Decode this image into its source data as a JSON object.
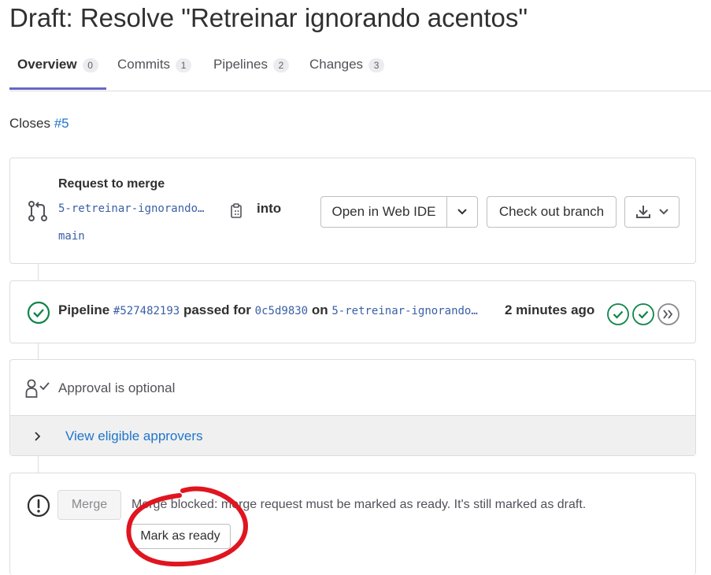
{
  "page": {
    "title": "Draft: Resolve \"Retreinar ignorando acentos\""
  },
  "tabs": [
    {
      "label": "Overview",
      "count": "0"
    },
    {
      "label": "Commits",
      "count": "1"
    },
    {
      "label": "Pipelines",
      "count": "2"
    },
    {
      "label": "Changes",
      "count": "3"
    }
  ],
  "description": {
    "prefix": "Closes",
    "issue_link": "#5"
  },
  "merge_request": {
    "heading": "Request to merge",
    "source_branch": "5-retreinar-ignorando…",
    "into_label": "into",
    "target_branch": "main",
    "open_web_ide": "Open in Web IDE",
    "checkout_branch": "Check out branch"
  },
  "pipeline": {
    "label": "Pipeline",
    "id": "#527482193",
    "status_text": "passed for",
    "commit": "0c5d9830",
    "on_label": "on",
    "branch": "5-retreinar-ignorando…",
    "time": "2 minutes ago",
    "stages": [
      "passed",
      "passed"
    ]
  },
  "approval": {
    "text": "Approval is optional",
    "view_approvers": "View eligible approvers"
  },
  "merge": {
    "button_label": "Merge",
    "message": "Merge blocked: merge request must be marked as ready. It's still marked as draft.",
    "mark_ready": "Mark as ready"
  },
  "colors": {
    "accent": "#6666c4",
    "link": "#1f75cb",
    "success": "#108548",
    "annotation": "#e0151f"
  }
}
